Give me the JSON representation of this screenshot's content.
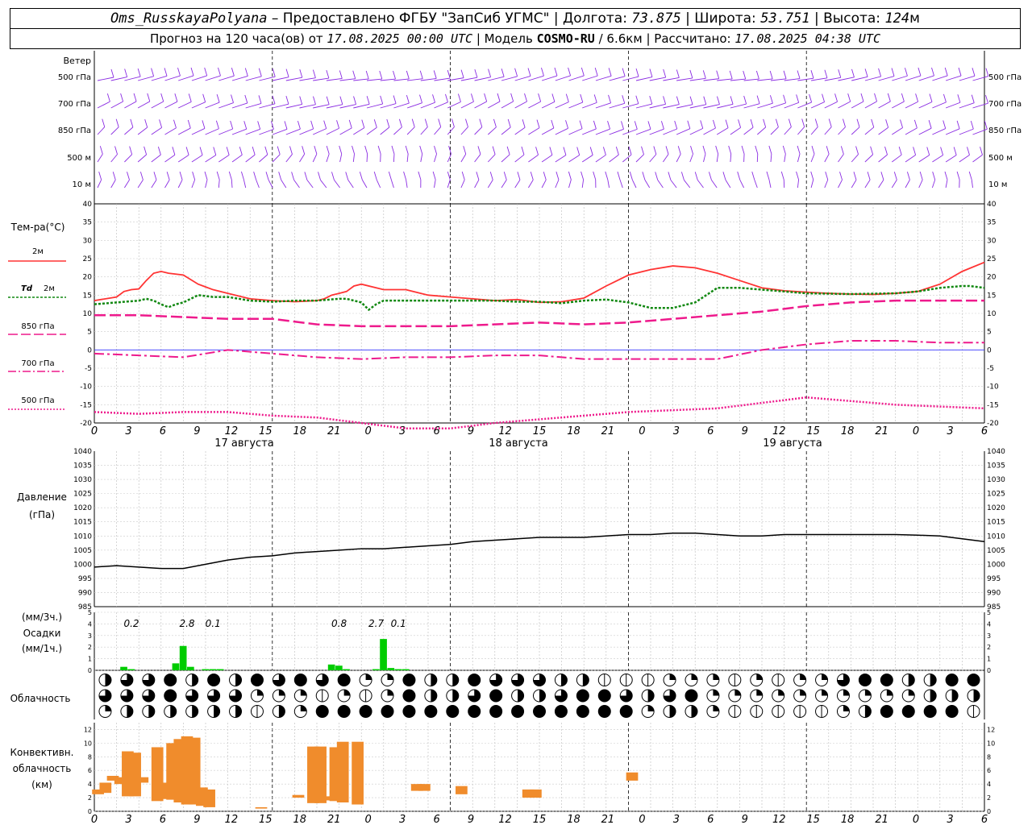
{
  "header": {
    "station": "Oms_RusskayaPolyana",
    "provider": "– Предоставлено ФГБУ \"ЗапСиб УГМС\" | Долгота:",
    "lon": "73.875",
    "lat_label": "| Широта:",
    "lat": "53.751",
    "alt_label": "| Высота:",
    "alt": "124",
    "alt_unit": "м",
    "forecast_prefix": "Прогноз на 120 часа(ов) от",
    "forecast_from": "17.08.2025 00:00 UTC",
    "model_label": "| Модель",
    "model": "COSMO-RU",
    "resolution": "/ 6.6км",
    "calc_label": "| Рассчитано:",
    "calc_time": "17.08.2025 04:38 UTC"
  },
  "labels": {
    "wind": "Ветер",
    "wind_levels": [
      "500 гПа",
      "700 гПа",
      "850 гПа",
      "500 м",
      "10 м"
    ],
    "temp": "Тем-ра(°C)",
    "t2m": "2м",
    "td": "Td",
    "td2": "2м",
    "t850": "850 гПа",
    "t700": "700 гПа",
    "t500": "500 гПа",
    "pressure": "Давление",
    "pressure_unit": "(гПа)",
    "precip_unit1": "(мм/3ч.)",
    "precip": "Осадки",
    "precip_unit2": "(мм/1ч.)",
    "cloud": "Облачность",
    "conv1": "Конвективн.",
    "conv2": "облачность",
    "conv3": "(км)"
  },
  "colors": {
    "wind": "#8a2be2",
    "t2m": "#ff3333",
    "td": "#118811",
    "t850": "#ee1a8c",
    "t700": "#ee1a8c",
    "t500": "#ee1a8c",
    "zero_line": "#3333ff",
    "pressure": "#000000",
    "precip": "#00cc00",
    "conv": "#f08c2c"
  },
  "time_axis": {
    "hour_ticks": [
      "0",
      "3",
      "6",
      "9",
      "12",
      "15",
      "18",
      "21",
      "0",
      "3",
      "6",
      "9",
      "12",
      "15",
      "18",
      "21",
      "0",
      "3",
      "6",
      "9",
      "12",
      "15",
      "18",
      "21",
      "0",
      "3",
      "6"
    ],
    "days": [
      "17 августа",
      "18 августа",
      "19 августа"
    ]
  },
  "chart_data": [
    {
      "type": "line",
      "title": "Тем-ра(°C)",
      "x_hours": [
        0,
        6,
        12,
        18,
        24,
        30,
        36,
        42,
        48,
        54,
        60,
        66,
        72,
        78
      ],
      "ylim": [
        -20,
        40
      ],
      "y_ticks": [
        "40",
        "35",
        "30",
        "25",
        "20",
        "15",
        "10",
        "5",
        "0",
        "-5",
        "-10",
        "-15",
        "-20"
      ],
      "series": [
        {
          "name": "2м",
          "style": "solid",
          "x": [
            0,
            3,
            4,
            5,
            6,
            7,
            8,
            9,
            10,
            12,
            14,
            16,
            18,
            21,
            24,
            27,
            30,
            31,
            32,
            33,
            34,
            35,
            36,
            39,
            42,
            45,
            48,
            51,
            54,
            57,
            60,
            63,
            66,
            69,
            72,
            75,
            78,
            81,
            84,
            87,
            90,
            93,
            96,
            99,
            102,
            105,
            108,
            111,
            114,
            117,
            120
          ],
          "values": [
            13.5,
            14.5,
            16,
            16.5,
            16.7,
            19,
            21,
            21.5,
            21,
            20.5,
            18,
            16.5,
            15.5,
            14,
            13.5,
            13.2,
            13.5,
            14,
            15,
            15.5,
            16,
            17.5,
            18,
            16.5,
            16.5,
            15,
            14.5,
            14,
            13.5,
            13.8,
            13,
            13.2,
            14.2,
            17.5,
            20.5,
            22,
            23,
            22.5,
            21,
            19,
            17,
            16.2,
            15.8,
            15.5,
            15.3,
            15.2,
            15.5,
            16,
            18,
            21.5,
            24
          ]
        },
        {
          "name": "Td 2м",
          "style": "dotted",
          "x": [
            0,
            3,
            6,
            7,
            8,
            9,
            10,
            11,
            12,
            14,
            16,
            18,
            21,
            24,
            27,
            30,
            33,
            34,
            35,
            36,
            37,
            38,
            39,
            42,
            45,
            48,
            51,
            54,
            57,
            60,
            63,
            66,
            69,
            72,
            75,
            78,
            81,
            84,
            87,
            90,
            93,
            96,
            99,
            102,
            105,
            108,
            111,
            114,
            117,
            118,
            120
          ],
          "values": [
            12.5,
            13,
            13.5,
            14,
            13.5,
            12.5,
            11.7,
            12.5,
            13,
            15,
            14.5,
            14.5,
            13.5,
            13.2,
            13.5,
            13.5,
            14,
            14,
            13.5,
            13,
            11,
            12.5,
            13.5,
            13.5,
            13.5,
            13.5,
            13.5,
            13.5,
            13.2,
            13.2,
            12.8,
            13.5,
            13.8,
            13,
            11.5,
            11.5,
            13,
            17,
            17,
            16.5,
            16,
            15.5,
            15.4,
            15.3,
            15.4,
            15.5,
            16,
            17,
            17.5,
            17.5,
            17
          ]
        },
        {
          "name": "850 гПа",
          "style": "longdash",
          "x": [
            0,
            6,
            12,
            18,
            24,
            30,
            36,
            42,
            48,
            54,
            60,
            66,
            72,
            78,
            84,
            90,
            96,
            102,
            108,
            114,
            120
          ],
          "values": [
            9.5,
            9.5,
            9,
            8.5,
            8.5,
            7,
            6.5,
            6.5,
            6.5,
            7,
            7.5,
            7,
            7.5,
            8.5,
            9.5,
            10.5,
            12,
            13,
            13.5,
            13.5,
            13.5
          ]
        },
        {
          "name": "700 гПа",
          "style": "dashdot",
          "x": [
            0,
            6,
            12,
            18,
            24,
            30,
            36,
            42,
            48,
            54,
            60,
            66,
            72,
            78,
            84,
            90,
            96,
            102,
            108,
            114,
            120
          ],
          "values": [
            -1,
            -1.5,
            -2,
            0,
            -1,
            -2,
            -2.5,
            -2,
            -2,
            -1.5,
            -1.5,
            -2.5,
            -2.5,
            -2.5,
            -2.5,
            0,
            1.5,
            2.5,
            2.5,
            2,
            2
          ]
        },
        {
          "name": "500 гПа",
          "style": "dotted",
          "x": [
            0,
            6,
            12,
            18,
            24,
            30,
            36,
            42,
            48,
            54,
            60,
            66,
            72,
            78,
            84,
            90,
            96,
            102,
            108,
            114,
            120
          ],
          "values": [
            -17,
            -17.5,
            -17,
            -17,
            -18,
            -18.5,
            -20,
            -21.5,
            -21.5,
            -20,
            -19,
            -18,
            -17,
            -16.5,
            -16,
            -14.5,
            -13,
            -14,
            -15,
            -15.5,
            -16
          ]
        }
      ]
    },
    {
      "type": "line",
      "title": "Давление",
      "ylabel": "(гПа)",
      "ylim": [
        985,
        1040
      ],
      "y_ticks": [
        "1040",
        "1035",
        "1030",
        "1025",
        "1020",
        "1015",
        "1010",
        "1005",
        "1000",
        "995",
        "990",
        "985"
      ],
      "series": [
        {
          "name": "Давление",
          "x": [
            0,
            3,
            6,
            9,
            12,
            15,
            18,
            21,
            24,
            27,
            30,
            33,
            36,
            39,
            42,
            45,
            48,
            51,
            54,
            57,
            60,
            63,
            66,
            69,
            72,
            75,
            78,
            81,
            84,
            87,
            90,
            93,
            96,
            99,
            102,
            105,
            108,
            111,
            114,
            117,
            120
          ],
          "values": [
            999,
            999.5,
            999,
            998.5,
            998.5,
            1000,
            1001.5,
            1002.5,
            1003,
            1004,
            1004.5,
            1005,
            1005.5,
            1005.5,
            1006,
            1006.5,
            1007,
            1008,
            1008.5,
            1009,
            1009.5,
            1009.5,
            1009.5,
            1010,
            1010.5,
            1010.5,
            1011,
            1011,
            1010.5,
            1010,
            1010,
            1010.5,
            1010.5,
            1010.5,
            1010.5,
            1010.5,
            1010.5,
            1010.3,
            1010,
            1009,
            1008
          ]
        }
      ]
    },
    {
      "type": "bar",
      "title": "Осадки",
      "ylabel": "(мм/1ч.)",
      "ylim": [
        0,
        5
      ],
      "y_ticks": [
        "5",
        "4",
        "3",
        "2",
        "1",
        "0"
      ],
      "x_hours": [
        4,
        5,
        11,
        12,
        13,
        15,
        16,
        17,
        32,
        33,
        34,
        38,
        39,
        40,
        41,
        42
      ],
      "values": [
        0.3,
        0.1,
        0.6,
        2.1,
        0.3,
        0.1,
        0.1,
        0.1,
        0.5,
        0.4,
        0.1,
        0.1,
        2.7,
        0.2,
        0.1,
        0.1
      ],
      "annotations": [
        {
          "x_hour": 5,
          "text": "0.2"
        },
        {
          "x_hour": 12.5,
          "text": "2.8"
        },
        {
          "x_hour": 16,
          "text": "0.1"
        },
        {
          "x_hour": 33,
          "text": "0.8"
        },
        {
          "x_hour": 38,
          "text": "2.7"
        },
        {
          "x_hour": 41,
          "text": "0.1"
        }
      ]
    },
    {
      "type": "bar",
      "title": "Конвективн. облачность",
      "ylabel": "(км)",
      "ylim": [
        0,
        13
      ],
      "y_ticks": [
        "12",
        "10",
        "8",
        "6",
        "4",
        "2",
        "0"
      ],
      "bars": [
        {
          "x_hour": 0.5,
          "base": 2.5,
          "top": 3.2
        },
        {
          "x_hour": 1.5,
          "base": 2.7,
          "top": 4.2
        },
        {
          "x_hour": 2.5,
          "base": 4.5,
          "top": 5.2
        },
        {
          "x_hour": 3.5,
          "base": 4.0,
          "top": 5.0
        },
        {
          "x_hour": 4.5,
          "base": 2.2,
          "top": 8.8
        },
        {
          "x_hour": 5.5,
          "base": 2.2,
          "top": 8.6
        },
        {
          "x_hour": 6.5,
          "base": 4.2,
          "top": 5.0
        },
        {
          "x_hour": 8.5,
          "base": 1.5,
          "top": 9.4
        },
        {
          "x_hour": 9.5,
          "base": 1.8,
          "top": 4.2
        },
        {
          "x_hour": 10.5,
          "base": 1.7,
          "top": 10.0
        },
        {
          "x_hour": 11.5,
          "base": 1.3,
          "top": 10.6
        },
        {
          "x_hour": 12.5,
          "base": 1.0,
          "top": 11.0
        },
        {
          "x_hour": 13.5,
          "base": 1.0,
          "top": 10.8
        },
        {
          "x_hour": 14.5,
          "base": 0.8,
          "top": 3.5
        },
        {
          "x_hour": 15.5,
          "base": 0.6,
          "top": 3.2
        },
        {
          "x_hour": 22.5,
          "base": 0.4,
          "top": 0.6
        },
        {
          "x_hour": 27.5,
          "base": 2.0,
          "top": 2.4
        },
        {
          "x_hour": 29.5,
          "base": 1.2,
          "top": 9.5
        },
        {
          "x_hour": 30.5,
          "base": 1.2,
          "top": 9.5
        },
        {
          "x_hour": 31.5,
          "base": 1.6,
          "top": 2.2
        },
        {
          "x_hour": 32.5,
          "base": 1.5,
          "top": 9.4
        },
        {
          "x_hour": 33.5,
          "base": 1.3,
          "top": 10.2
        },
        {
          "x_hour": 35.5,
          "base": 1.0,
          "top": 10.2
        },
        {
          "x_hour": 43.5,
          "base": 3.0,
          "top": 4.0
        },
        {
          "x_hour": 44.5,
          "base": 3.0,
          "top": 4.0
        },
        {
          "x_hour": 49.5,
          "base": 2.5,
          "top": 3.7
        },
        {
          "x_hour": 58.5,
          "base": 2.0,
          "top": 3.2
        },
        {
          "x_hour": 59.5,
          "base": 2.0,
          "top": 3.2
        },
        {
          "x_hour": 72.5,
          "base": 4.5,
          "top": 5.7
        }
      ]
    }
  ],
  "cloud_rows": [
    "3333320001222000000011110000000000023322200111111111111111111111111111111111111111111111111111111111110000000000000000000000000000000000000000000000000000000000000000000000000000000000000000000000000000000000000000000000000000000000000000000000000000000000000000000000000000000000000000000000000000000000000000000000000000000000000000000000000000000000000000000000000000000000000000000000",
    "",
    ""
  ]
}
